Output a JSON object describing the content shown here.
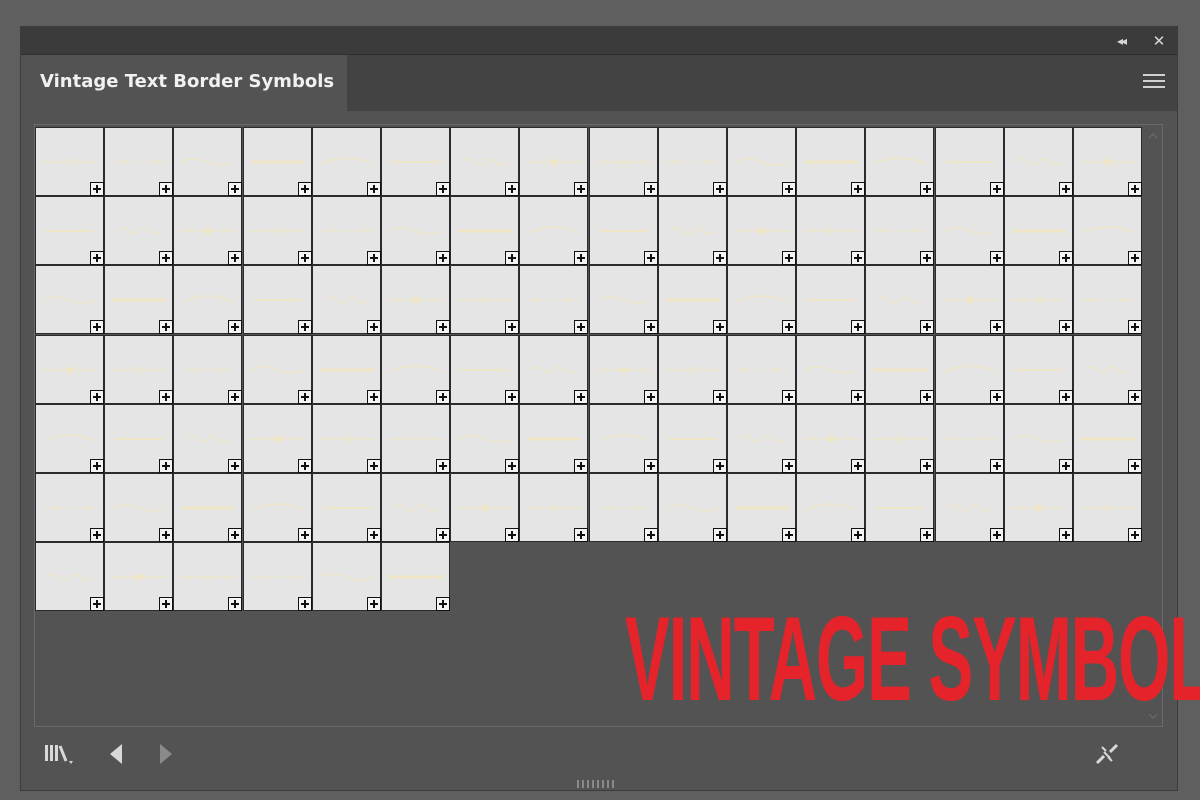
{
  "panel": {
    "tab_title": "Vintage Text Border Symbols",
    "collapse_label": "◂◂",
    "close_label": "✕"
  },
  "overlay": {
    "headline": "VINTAGE SYMBOLS",
    "color": "#e5232a"
  },
  "grid": {
    "columns": 16,
    "rows_full": 6,
    "last_row_count": 6,
    "symbol_count": 102,
    "ornament_color": "#efe6c8",
    "tile_bg": "#e5e5e5"
  },
  "icons": {
    "libraries": "symbol-libraries-menu-icon",
    "prev": "previous-library-icon",
    "next": "next-library-icon",
    "break_link": "break-link-to-symbol-icon",
    "menu": "panel-menu-icon"
  }
}
